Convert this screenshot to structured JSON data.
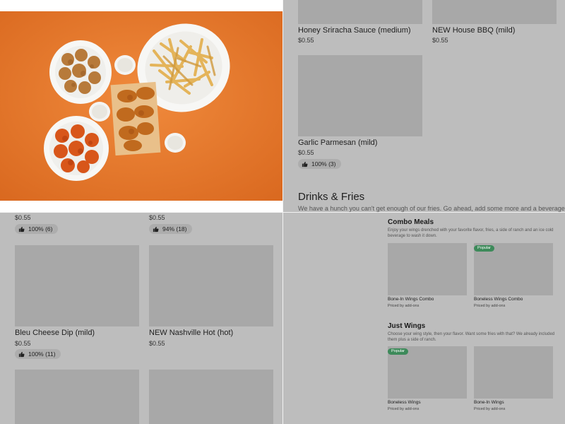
{
  "top_right": {
    "items": [
      {
        "name": "Honey Sriracha Sauce (medium)",
        "price": "$0.55"
      },
      {
        "name": "NEW House BBQ (mild)",
        "price": "$0.55"
      },
      {
        "name": "Garlic Parmesan (mild)",
        "price": "$0.55",
        "rating": "100% (3)"
      }
    ],
    "section_title": "Drinks & Fries",
    "section_desc": "We have a hunch you can't get enough of our fries. Go ahead, add some more and a beverage"
  },
  "bottom_left": {
    "top_prices": [
      "$0.55",
      "$0.55"
    ],
    "top_ratings": [
      "100% (6)",
      "94% (18)"
    ],
    "items": [
      {
        "name": "Bleu Cheese Dip (mild)",
        "price": "$0.55",
        "rating": "100% (11)"
      },
      {
        "name": "NEW Nashville Hot (hot)",
        "price": "$0.55"
      }
    ]
  },
  "bottom_right": {
    "combo_title": "Combo Meals",
    "combo_desc": "Enjoy your wings drenched with your favorite flavor, fries, a side of ranch and an ice cold beverage to wash it down.",
    "combo_items": [
      {
        "name": "Bone-In Wings Combo",
        "sub": "Priced by add-ons"
      },
      {
        "name": "Boneless Wings Combo",
        "sub": "Priced by add-ons",
        "badge": "Popular"
      }
    ],
    "wings_title": "Just Wings",
    "wings_desc": "Choose your wing style, then your flavor. Want some fries with that? We already included them plus a side of ranch.",
    "wings_items": [
      {
        "name": "Boneless Wings",
        "sub": "Priced by add-ons",
        "badge": "Popular"
      },
      {
        "name": "Bone-In Wings",
        "sub": "Priced by add-ons"
      }
    ]
  },
  "colors": {
    "overlay": "#bdbdbd",
    "placeholder": "#a8a8a8",
    "hero_background": "#e8772a",
    "popular_badge": "#3d8a5a"
  },
  "icons": {
    "rating": "thumbs-up-icon"
  }
}
